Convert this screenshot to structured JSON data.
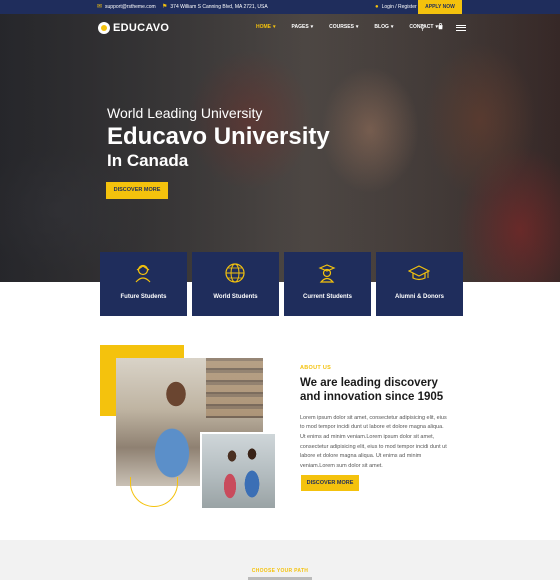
{
  "topbar": {
    "email": "support@rstheme.com",
    "address": "374 William S Canning Blvd, MA 2721, USA",
    "login": "Login / Register",
    "apply": "APPLY NOW",
    "email_icon": "envelope-icon",
    "address_icon": "location-pin-icon",
    "login_icon": "user-icon"
  },
  "nav": {
    "logo": "EDUCAVO",
    "items": [
      {
        "label": "HOME",
        "arrow": "▾"
      },
      {
        "label": "PAGES",
        "arrow": "▾"
      },
      {
        "label": "COURSES",
        "arrow": "▾"
      },
      {
        "label": "BLOG",
        "arrow": "▾"
      },
      {
        "label": "CONTACT",
        "arrow": "▾"
      }
    ],
    "search_icon": "⚲",
    "cart_icon": "🛍"
  },
  "hero": {
    "kicker": "World Leading University",
    "title": "Educavo University",
    "subtitle": "In Canada",
    "button": "DISCOVER MORE"
  },
  "cards": [
    {
      "label": "Future Students",
      "icon": "student-icon"
    },
    {
      "label": "World Students",
      "icon": "globe-icon"
    },
    {
      "label": "Current Students",
      "icon": "graduate-icon"
    },
    {
      "label": "Alumni & Donors",
      "icon": "mortarboard-icon"
    }
  ],
  "about": {
    "kicker": "ABOUT US",
    "heading": "We are leading discovery and innovation since 1905",
    "body": "Lorem ipsum dolor sit amet, consectetur adipisicing elit, eius to mod tempor incidi dunt ut labore et dolore magna aliqua. Ut enims ad minim veniam.Lorem ipsum dolor sit amet, consectetur adipisicing elit, eius to mod tempor incidi dunt ut labore et dolore magna aliqua. Ut enims ad minim veniam.Lorem sum dolor sit amet.",
    "button": "DISCOVER MORE"
  },
  "path": {
    "kicker": "CHOOSE YOUR PATH"
  },
  "colors": {
    "navy": "#1f2d5c",
    "yellow": "#f4c20d"
  }
}
